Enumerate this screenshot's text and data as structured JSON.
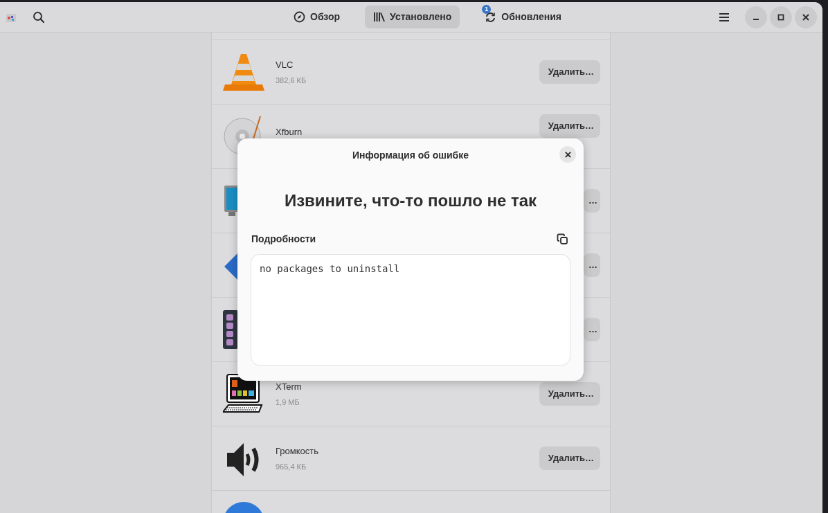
{
  "header": {
    "tabs": [
      {
        "label": "Обзор",
        "selected": false
      },
      {
        "label": "Установлено",
        "selected": true
      },
      {
        "label": "Обновления",
        "badge": "1",
        "selected": false
      }
    ]
  },
  "apps": [
    {
      "kind": "app",
      "name": "VLC",
      "size": "382,6 КБ",
      "button": "Удалить…"
    },
    {
      "kind": "app",
      "name": "Xfburn",
      "button": "Удалить…"
    },
    {
      "kind": "app",
      "button": "…"
    },
    {
      "kind": "app",
      "button": "…"
    },
    {
      "kind": "app",
      "button": "…"
    },
    {
      "kind": "app",
      "name": "XTerm",
      "size": "1,9 МБ",
      "button": "Удалить…"
    },
    {
      "kind": "app",
      "name": "Громкость",
      "size": "965,4 КБ",
      "button": "Удалить…"
    },
    {
      "kind": "app"
    }
  ],
  "dialog": {
    "title": "Информация об ошибке",
    "heading": "Извините, что-то пошло не так",
    "details_label": "Подробности",
    "details_text": "no packages to uninstall"
  }
}
